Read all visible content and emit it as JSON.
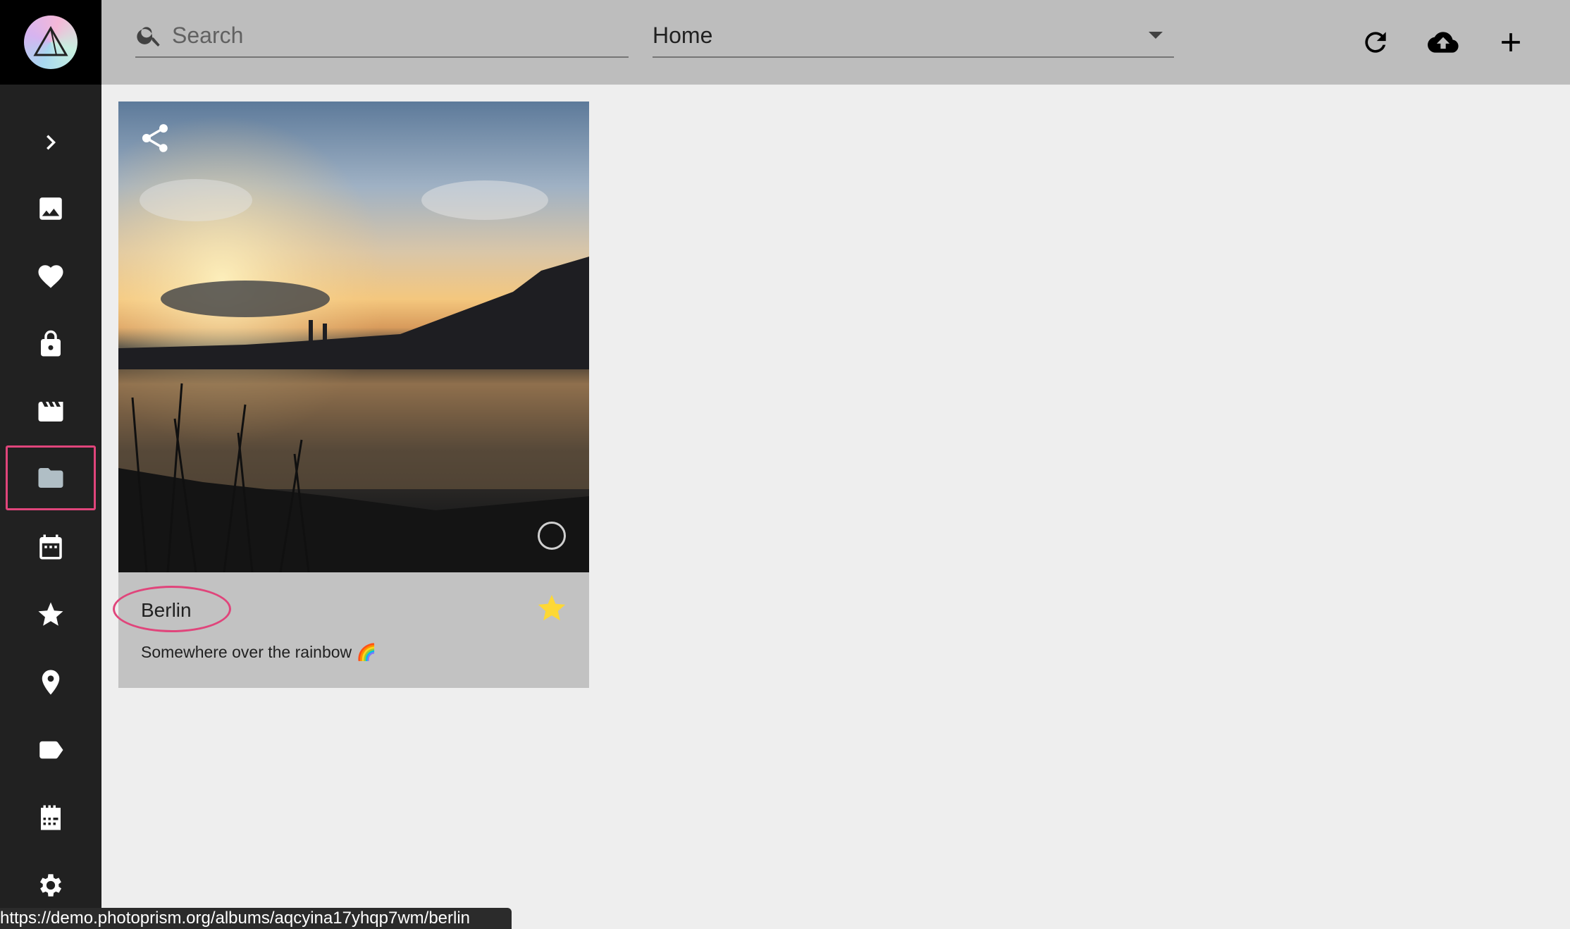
{
  "sidebar": {
    "items": [
      {
        "name": "expand",
        "icon": "chevron-right-icon"
      },
      {
        "name": "photos",
        "icon": "image-icon"
      },
      {
        "name": "favorites",
        "icon": "heart-icon"
      },
      {
        "name": "private",
        "icon": "lock-icon"
      },
      {
        "name": "videos",
        "icon": "movie-icon"
      },
      {
        "name": "folders",
        "icon": "folder-icon",
        "active": true
      },
      {
        "name": "calendar",
        "icon": "calendar-icon"
      },
      {
        "name": "moments",
        "icon": "star-icon"
      },
      {
        "name": "places",
        "icon": "place-icon"
      },
      {
        "name": "labels",
        "icon": "label-icon"
      },
      {
        "name": "library",
        "icon": "library-icon"
      },
      {
        "name": "settings",
        "icon": "gear-icon"
      }
    ]
  },
  "toolbar": {
    "search_placeholder": "Search",
    "search_value": "",
    "select_value": "Home",
    "actions": [
      "refresh-icon",
      "upload-cloud-icon",
      "add-icon"
    ]
  },
  "album": {
    "title": "Berlin",
    "description": "Somewhere over the rainbow 🌈",
    "favorite": true
  },
  "status_url": "https://demo.photoprism.org/albums/aqcyina17yhqp7wm/berlin",
  "colors": {
    "sidebar_bg": "#212121",
    "toolbar_bg": "#bdbdbd",
    "content_bg": "#eeeeee",
    "card_bg": "#c2c2c2",
    "highlight": "#e0457b",
    "star": "#fdd835"
  }
}
